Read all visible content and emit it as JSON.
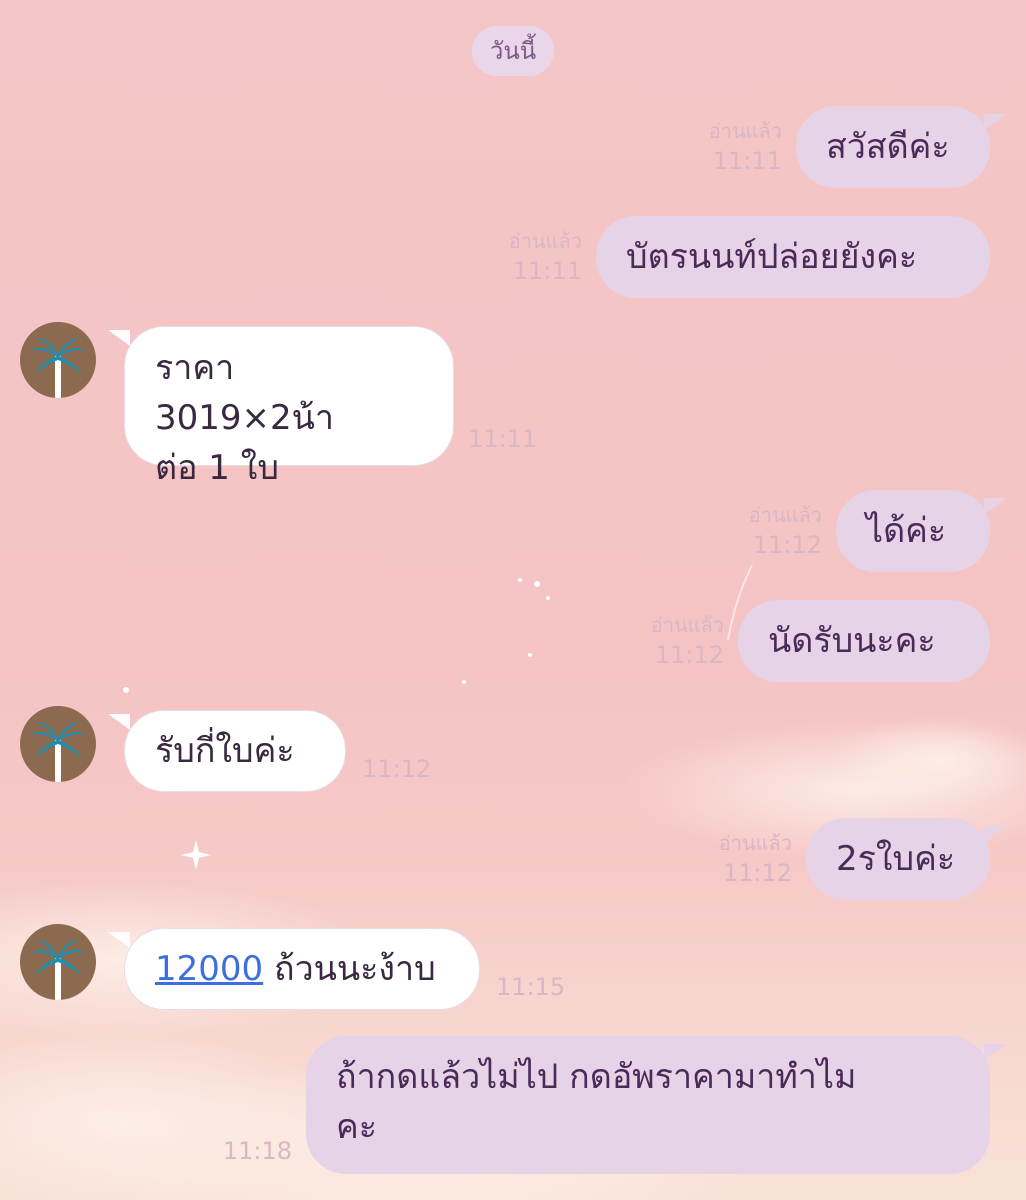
{
  "chat": {
    "date_label": "วันนี้",
    "read_label": "อ่านแล้ว",
    "messages": [
      {
        "text": "สวัสดีค่ะ",
        "time": "11:11"
      },
      {
        "text": "บัตรนนท์ปล่อยยังคะ",
        "time": "11:11"
      },
      {
        "text_line1": "ราคา 3019×2น้า",
        "text_line2": "ต่อ 1 ใบ",
        "time": "11:11"
      },
      {
        "text": "ได้ค่ะ",
        "time": "11:12"
      },
      {
        "text": "นัดรับนะคะ",
        "time": "11:12"
      },
      {
        "text": "รับกี่ใบค่ะ",
        "time": "11:12"
      },
      {
        "text": "2รใบค่ะ",
        "time": "11:12"
      },
      {
        "link": "12000",
        "text": " ถ้วนนะง้าบ",
        "time": "11:15"
      },
      {
        "text_line1": "ถ้ากดแล้วไม่ไป กดอัพราคามาทำไม",
        "text_line2": "คะ",
        "time": "11:18"
      }
    ]
  },
  "colors": {
    "outgoing_bubble": "#e6d3e8",
    "incoming_bubble": "#ffffff",
    "background": "#f5c6c7",
    "meta_text": "#d9b7c4",
    "link": "#3c6ee0",
    "avatar_bg": "#8b6a4f",
    "palm_leaf": "#1f8fb0"
  },
  "icons": {
    "avatar": "palm-tree-icon"
  }
}
